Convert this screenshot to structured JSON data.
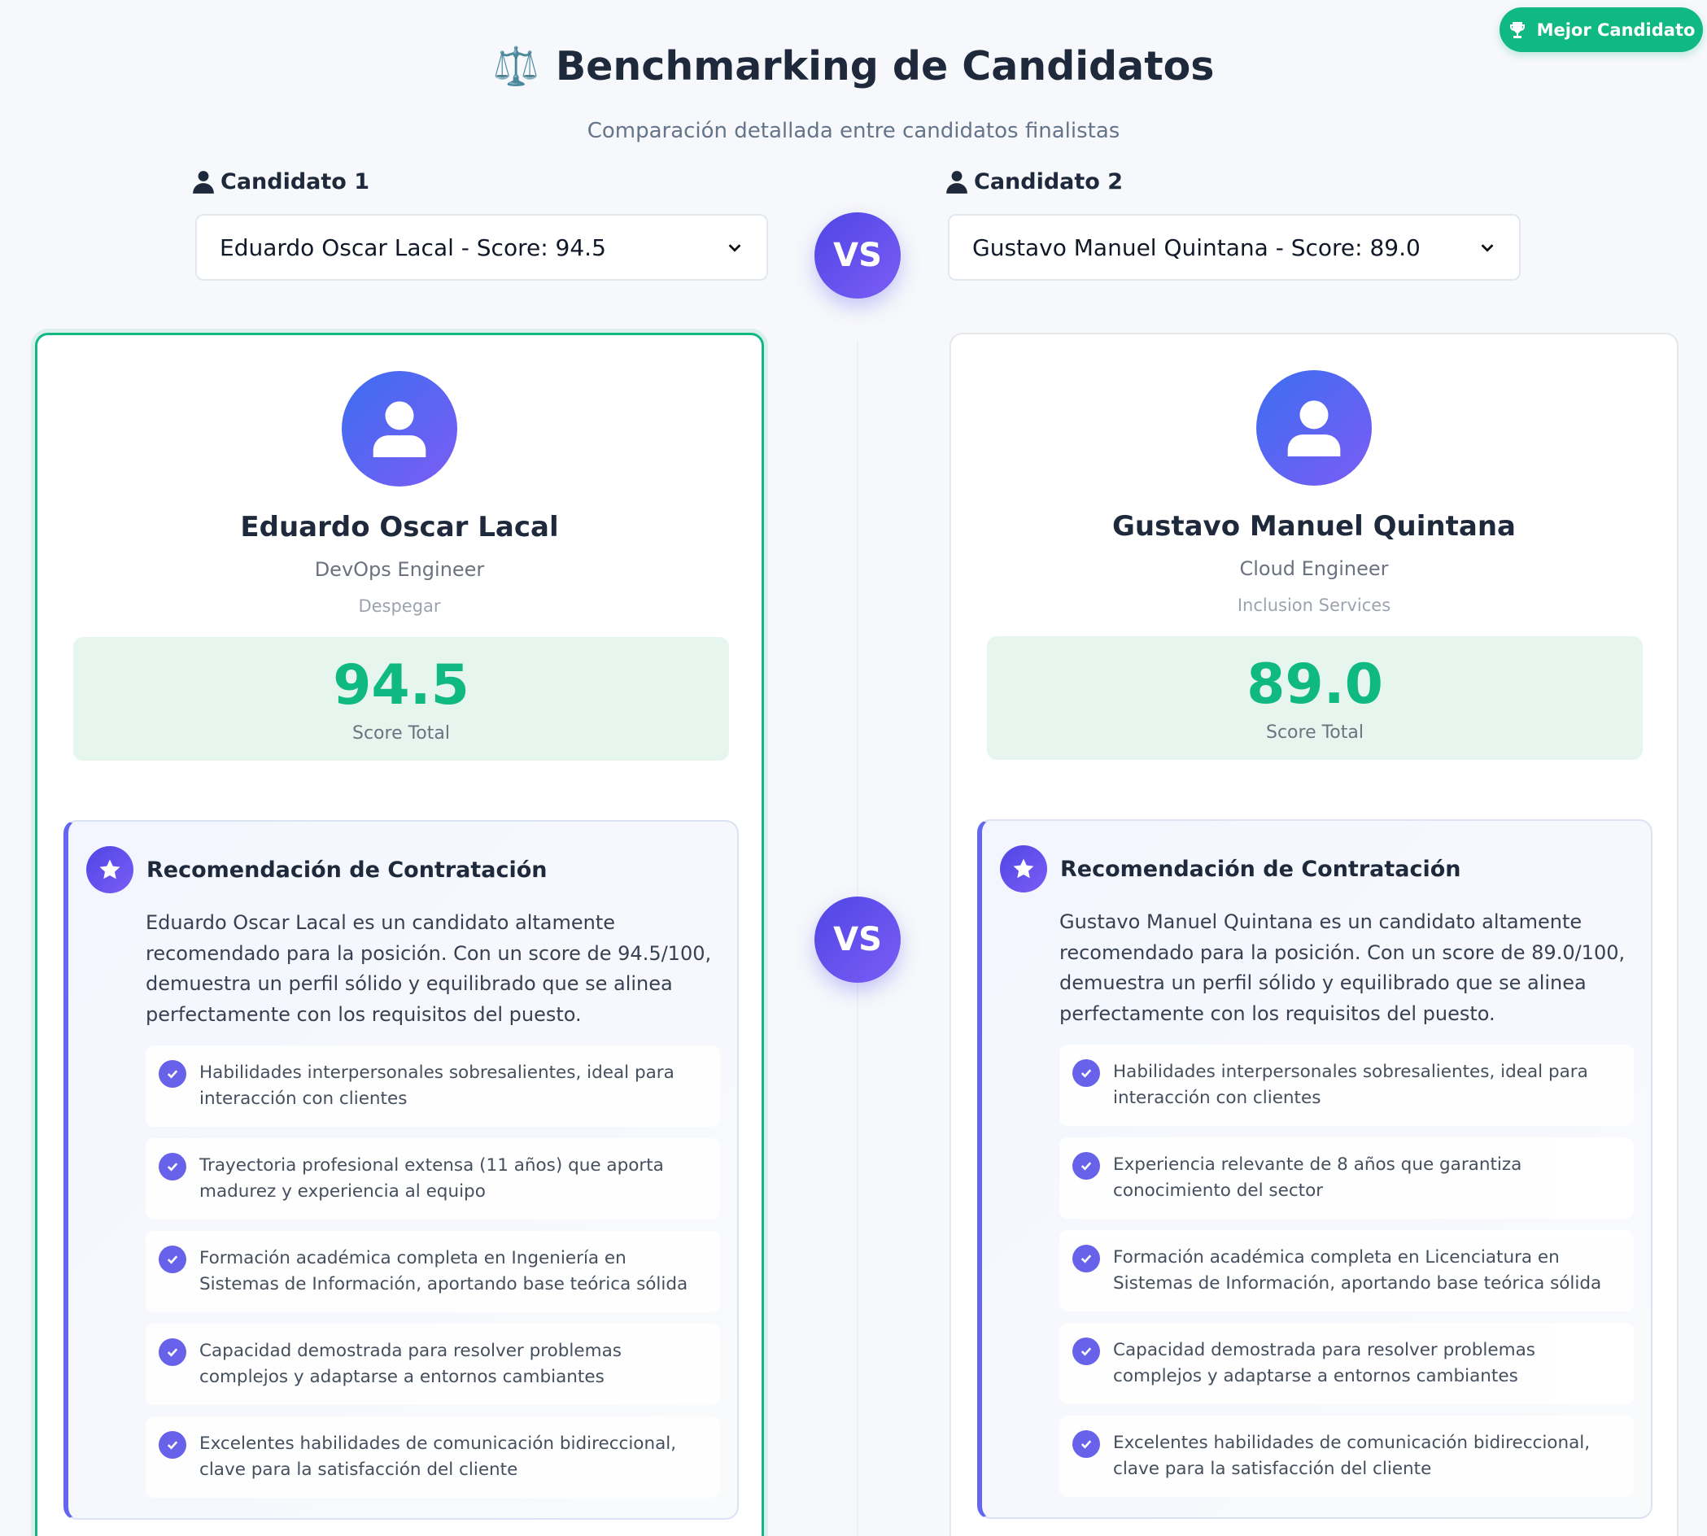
{
  "header": {
    "icon": "scale-icon",
    "title": "Benchmarking de Candidatos",
    "subtitle": "Comparación detallada entre candidatos finalistas",
    "best_badge": "Mejor Candidato"
  },
  "selectors": {
    "left_label": "Candidato 1",
    "left_value": "Eduardo Oscar Lacal - Score: 94.5",
    "right_label": "Candidato 2",
    "right_value": "Gustavo Manuel Quintana - Score: 89.0",
    "vs_label": "VS"
  },
  "colors": {
    "accent": "#6366f1",
    "success": "#10b981",
    "background": "#f7f8fb"
  },
  "candidates": [
    {
      "name": "Eduardo Oscar Lacal",
      "role": "DevOps Engineer",
      "company": "Despegar",
      "score": "94.5",
      "score_label": "Score Total",
      "reco_title": "Recomendación de Contratación",
      "reco_text": "Eduardo Oscar Lacal es un candidato altamente recomendado para la posición. Con un score de 94.5/100, demuestra un perfil sólido y equilibrado que se alinea perfectamente con los requisitos del puesto.",
      "points": [
        "Habilidades interpersonales sobresalientes, ideal para interacción con clientes",
        "Trayectoria profesional extensa (11 años) que aporta madurez y experiencia al equipo",
        "Formación académica completa en Ingeniería en Sistemas de Información, aportando base teórica sólida",
        "Capacidad demostrada para resolver problemas complejos y adaptarse a entornos cambiantes",
        "Excelentes habilidades de comunicación bidireccional, clave para la satisfacción del cliente"
      ]
    },
    {
      "name": "Gustavo Manuel Quintana",
      "role": "Cloud Engineer",
      "company": "Inclusion Services",
      "score": "89.0",
      "score_label": "Score Total",
      "reco_title": "Recomendación de Contratación",
      "reco_text": "Gustavo Manuel Quintana es un candidato altamente recomendado para la posición. Con un score de 89.0/100, demuestra un perfil sólido y equilibrado que se alinea perfectamente con los requisitos del puesto.",
      "points": [
        "Habilidades interpersonales sobresalientes, ideal para interacción con clientes",
        "Experiencia relevante de 8 años que garantiza conocimiento del sector",
        "Formación académica completa en Licenciatura en Sistemas de Información, aportando base teórica sólida",
        "Capacidad demostrada para resolver problemas complejos y adaptarse a entornos cambiantes",
        "Excelentes habilidades de comunicación bidireccional, clave para la satisfacción del cliente"
      ]
    }
  ]
}
